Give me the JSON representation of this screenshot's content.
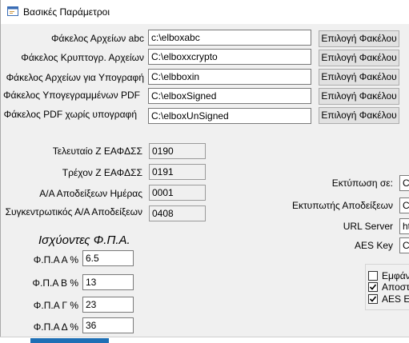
{
  "window": {
    "title": "Βασικές Παράμετροι"
  },
  "folders": [
    {
      "label": "Φάκελος Αρχείων abc",
      "value": "c:\\elboxabc",
      "button": "Επιλογή Φακέλου"
    },
    {
      "label": "Φάκελος Κρυπτογρ. Αρχείων",
      "value": "C:\\elboxxcrypto",
      "button": "Επιλογή Φακέλου"
    },
    {
      "label": "Φάκελος Αρχείων για Υπογραφή",
      "value": "C:\\elbboxin",
      "button": "Επιλογή Φακέλου"
    },
    {
      "label": "Φάκελος Υπογεγραμμένων PDF",
      "value": "C:\\elboxSigned",
      "button": "Επιλογή Φακέλου"
    },
    {
      "label": "Φάκελος PDF χωρίς υπογραφή",
      "value": "C:\\elboxUnSigned",
      "button": "Επιλογή Φακέλου"
    }
  ],
  "counters": [
    {
      "label": "Τελευταίο  Ζ  ΕΑΦΔΣΣ",
      "value": "0190"
    },
    {
      "label": "Τρέχον Ζ  ΕΑΦΔΣΣ",
      "value": "0191"
    },
    {
      "label": "Α/Α Αποδείξεων Ημέρας",
      "value": "0001"
    },
    {
      "label": "Συγκεντρωτικός Α/Α Αποδείξεων",
      "value": "0408"
    }
  ],
  "vat": {
    "heading": "Ισχύοντες Φ.Π.Α.",
    "rates": [
      {
        "label": "Φ.Π.Α Α %",
        "value": "6.5"
      },
      {
        "label": "Φ.Π.Α Β %",
        "value": "13"
      },
      {
        "label": "Φ.Π.Α Γ %",
        "value": "23"
      },
      {
        "label": "Φ.Π.Α Δ %",
        "value": "36"
      }
    ]
  },
  "settings": [
    {
      "label": "Εκτύπωση σε:",
      "value": "Ca"
    },
    {
      "label": "Εκτυπωτής Αποδείξεων",
      "value": "Ca"
    },
    {
      "label": "URL Server",
      "value": "htt"
    },
    {
      "label": "AES Key",
      "value": "C:"
    }
  ],
  "options": [
    {
      "label": "Εμφάν",
      "checked": false
    },
    {
      "label": "Αποστο",
      "checked": true
    },
    {
      "label": "AES En",
      "checked": true
    }
  ]
}
